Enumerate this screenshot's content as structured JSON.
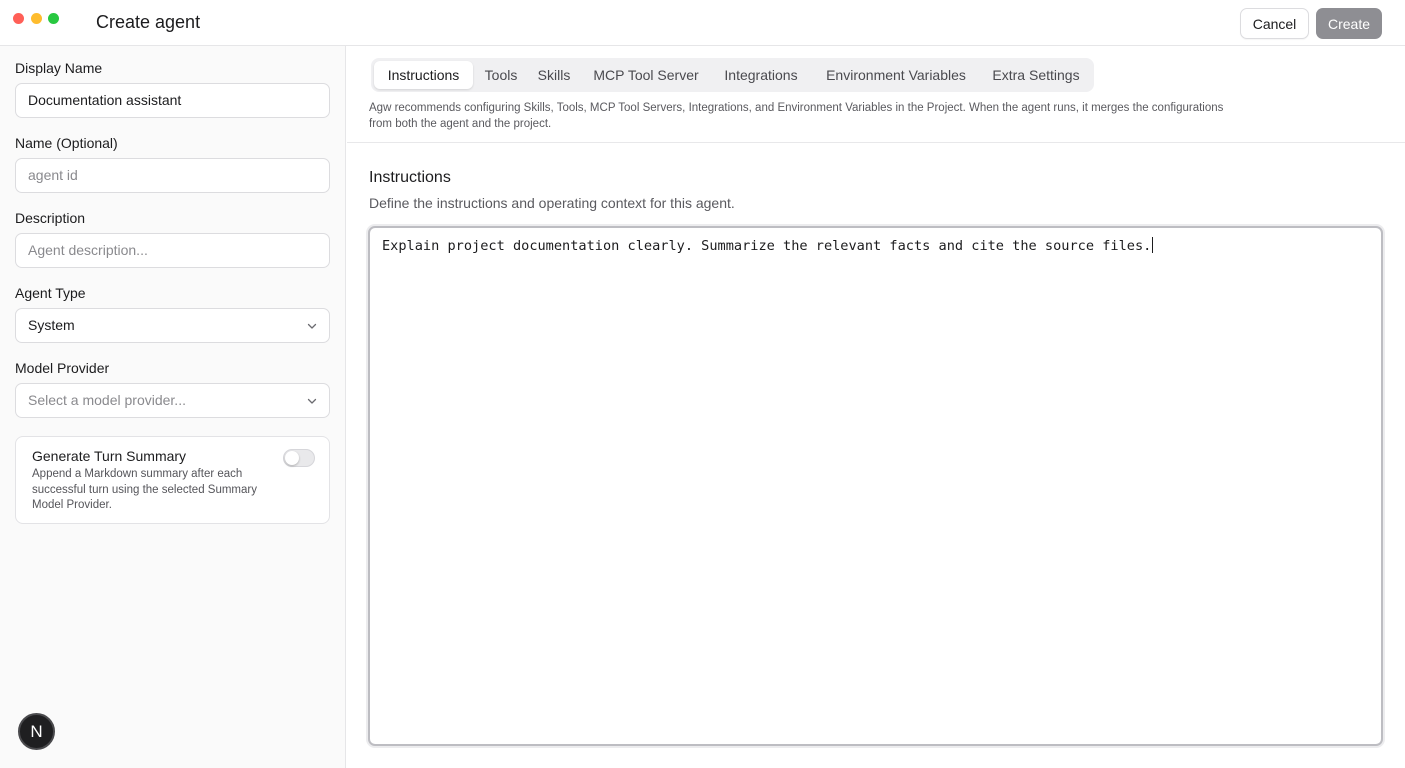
{
  "window": {
    "title": "Create agent"
  },
  "header": {
    "cancel_label": "Cancel",
    "create_label": "Create"
  },
  "sidebar": {
    "display_name": {
      "label": "Display Name",
      "value": "Documentation assistant"
    },
    "name": {
      "label": "Name (Optional)",
      "placeholder": "agent id"
    },
    "description": {
      "label": "Description",
      "placeholder": "Agent description..."
    },
    "agent_type": {
      "label": "Agent Type",
      "value": "System"
    },
    "model_provider": {
      "label": "Model Provider",
      "placeholder": "Select a model provider..."
    },
    "turn_summary": {
      "title": "Generate Turn Summary",
      "description": "Append a Markdown summary after each successful turn using the selected Summary Model Provider.",
      "enabled": false
    },
    "avatar_letter": "N"
  },
  "main": {
    "tabs": [
      {
        "label": "Instructions",
        "active": true
      },
      {
        "label": "Tools",
        "active": false
      },
      {
        "label": "Skills",
        "active": false
      },
      {
        "label": "MCP Tool Server",
        "active": false
      },
      {
        "label": "Integrations",
        "active": false
      },
      {
        "label": "Environment Variables",
        "active": false
      },
      {
        "label": "Extra Settings",
        "active": false
      }
    ],
    "notice": "Agw recommends configuring Skills, Tools, MCP Tool Servers, Integrations, and Environment Variables in the Project. When the agent runs, it merges the configurations from both the agent and the project.",
    "section_title": "Instructions",
    "section_description": "Define the instructions and operating context for this agent.",
    "instructions_text": "Explain project documentation clearly. Summarize the relevant facts and cite the source files."
  },
  "colors": {
    "create_button": "#8e8e93",
    "traffic_red": "#ff5f57",
    "traffic_yellow": "#febc2e",
    "traffic_green": "#28c840"
  }
}
